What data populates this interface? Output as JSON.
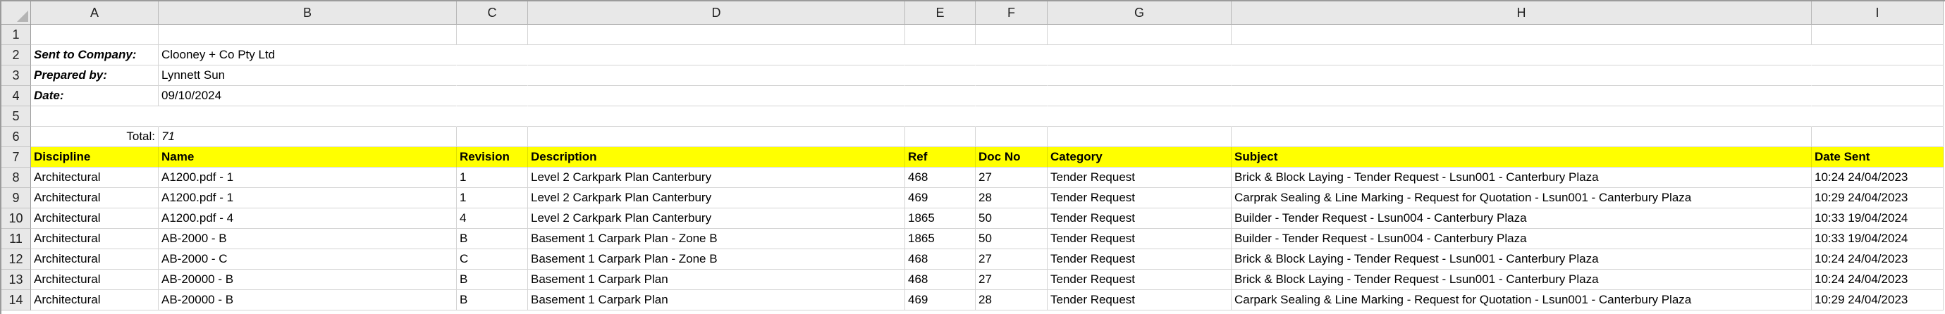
{
  "columns": [
    "A",
    "B",
    "C",
    "D",
    "E",
    "F",
    "G",
    "H",
    "I"
  ],
  "row_numbers": [
    "1",
    "2",
    "3",
    "4",
    "5",
    "6",
    "7",
    "8",
    "9",
    "10",
    "11",
    "12",
    "13",
    "14"
  ],
  "info": {
    "sent_to_label": "Sent to Company:",
    "sent_to_value": "Clooney + Co Pty Ltd",
    "prepared_by_label": "Prepared by:",
    "prepared_by_value": "Lynnett Sun",
    "date_label": "Date:",
    "date_value": "09/10/2024",
    "total_label": "Total:",
    "total_value": "71"
  },
  "table": {
    "headers": [
      "Discipline",
      "Name",
      "Revision",
      "Description",
      "Ref",
      "Doc No",
      "Category",
      "Subject",
      "Date Sent"
    ],
    "rows": [
      [
        "Architectural",
        "A1200.pdf - 1",
        "1",
        "Level 2 Carkpark Plan Canterbury",
        "468",
        "27",
        "Tender Request",
        "Brick & Block Laying - Tender Request - Lsun001 - Canterbury Plaza",
        "10:24 24/04/2023"
      ],
      [
        "Architectural",
        "A1200.pdf - 1",
        "1",
        "Level 2 Carkpark Plan Canterbury",
        "469",
        "28",
        "Tender Request",
        "Carprak Sealing & Line Marking - Request for Quotation - Lsun001 - Canterbury Plaza",
        "10:29 24/04/2023"
      ],
      [
        "Architectural",
        "A1200.pdf - 4",
        "4",
        "Level 2 Carkpark Plan Canterbury",
        "1865",
        "50",
        "Tender Request",
        "Builder - Tender Request - Lsun004 - Canterbury Plaza",
        "10:33 19/04/2024"
      ],
      [
        "Architectural",
        "AB-2000 - B",
        "B",
        "Basement 1 Carpark Plan - Zone B",
        "1865",
        "50",
        "Tender Request",
        "Builder - Tender Request - Lsun004 - Canterbury Plaza",
        "10:33 19/04/2024"
      ],
      [
        "Architectural",
        "AB-2000 - C",
        "C",
        "Basement 1 Carpark Plan - Zone B",
        "468",
        "27",
        "Tender Request",
        "Brick & Block Laying - Tender Request - Lsun001 - Canterbury Plaza",
        "10:24 24/04/2023"
      ],
      [
        "Architectural",
        "AB-20000 - B",
        "B",
        "Basement 1 Carpark Plan",
        "468",
        "27",
        "Tender Request",
        "Brick & Block Laying - Tender Request - Lsun001 - Canterbury Plaza",
        "10:24 24/04/2023"
      ],
      [
        "Architectural",
        "AB-20000 - B",
        "B",
        "Basement 1 Carpark Plan",
        "469",
        "28",
        "Tender Request",
        "Carpark Sealing & Line Marking - Request for Quotation - Lsun001 - Canterbury Plaza",
        "10:29 24/04/2023"
      ]
    ]
  },
  "colors": {
    "header_highlight": "#ffff00",
    "grid_line": "#d4d4d4",
    "heading_bg": "#e8e8e8"
  }
}
